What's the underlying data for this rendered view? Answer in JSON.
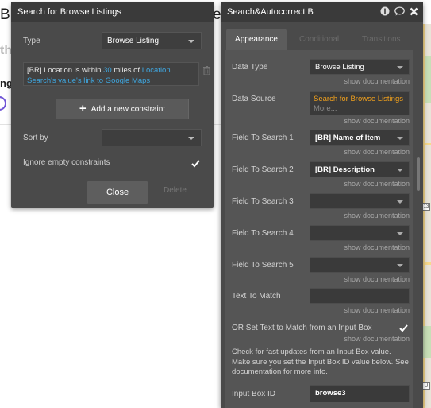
{
  "background": {
    "letter_left": "B",
    "faded_text": "th",
    "partial_text": "ng",
    "letter_right": "e"
  },
  "map": {
    "labels": [
      "13",
      "U"
    ]
  },
  "search_popup": {
    "title": "Search for Browse Listings",
    "type_label": "Type",
    "type_value": "Browse Listing",
    "constraint": {
      "prefix": "[BR] Location is within ",
      "distance": "30",
      "middle": " miles of ",
      "target": "Location Search's value's link to Google Maps"
    },
    "add_constraint_label": "Add a new constraint",
    "sort_by_label": "Sort by",
    "sort_by_value": "",
    "ignore_empty_label": "Ignore empty constraints",
    "ignore_empty_checked": true,
    "close_label": "Close",
    "delete_label": "Delete"
  },
  "property_panel": {
    "title": "Search&Autocorrect B",
    "header_icons": [
      "info-icon",
      "comment-icon",
      "close-icon"
    ],
    "tabs": [
      {
        "label": "Appearance",
        "active": true
      },
      {
        "label": "Conditional",
        "active": false
      },
      {
        "label": "Transitions",
        "active": false
      }
    ],
    "show_documentation": "show documentation",
    "data_type_label": "Data Type",
    "data_type_value": "Browse Listing",
    "data_source_label": "Data Source",
    "data_source_value": "Search for Browse Listings",
    "data_source_more": "More...",
    "fields": [
      {
        "label": "Field To Search 1",
        "value": "[BR] Name of Item"
      },
      {
        "label": "Field To Search 2",
        "value": "[BR] Description"
      },
      {
        "label": "Field To Search 3",
        "value": ""
      },
      {
        "label": "Field To Search 4",
        "value": ""
      },
      {
        "label": "Field To Search 5",
        "value": ""
      }
    ],
    "text_to_match_label": "Text To Match",
    "text_to_match_value": "",
    "or_input_label": "OR Set Text to Match from an Input Box",
    "or_input_checked": true,
    "note": "Check for fast updates from an Input Box value. Make sure you set the Input Box ID value below. See documentation for more info.",
    "input_box_id_label": "Input Box ID",
    "input_box_id_value": "browse3"
  },
  "colors": {
    "panel_bg": "#4a4a4a",
    "header_bg": "#3a3a3a",
    "link_blue": "#3fa7e0",
    "dynamic_orange": "#f3a21c",
    "accent_purple": "#6f54d6"
  }
}
